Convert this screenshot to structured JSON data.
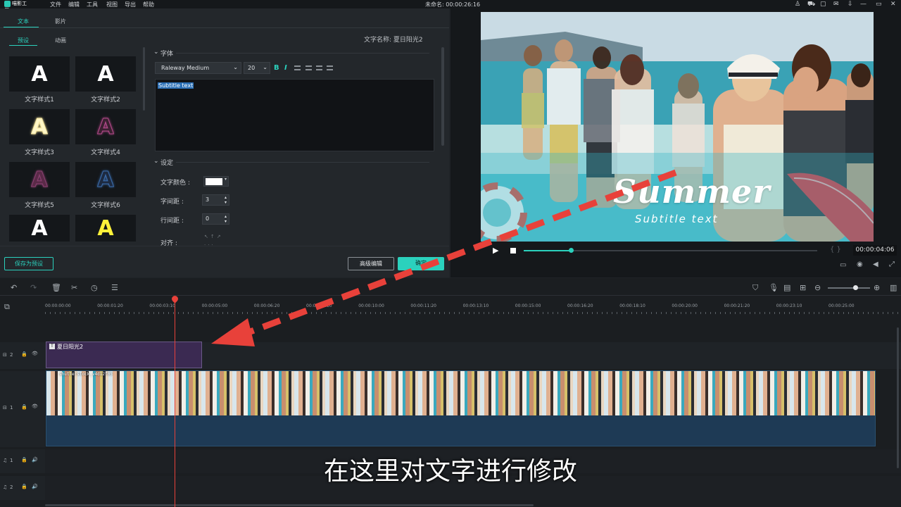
{
  "menubar": {
    "logo": "喵影工厂",
    "items": [
      "文件",
      "编辑",
      "工具",
      "视图",
      "导出",
      "帮助"
    ],
    "project_title": "未命名: 00:00:26:16"
  },
  "left": {
    "tabs": [
      "文本",
      "影片"
    ],
    "subtabs": [
      "预设",
      "动画"
    ],
    "text_name": "文字名称: 夏日阳光2",
    "styles": [
      {
        "label": "文字样式1",
        "color": "#ffffff",
        "glow": "none"
      },
      {
        "label": "文字样式2",
        "color": "#ffffff",
        "glow": "none"
      },
      {
        "label": "文字样式3",
        "color": "#fff7c8",
        "glow": "#f7e7a0"
      },
      {
        "label": "文字样式4",
        "color": "#3a2030",
        "glow": "#b04888"
      },
      {
        "label": "文字样式5",
        "color": "#5a2a48",
        "glow": "#8a4070"
      },
      {
        "label": "文字样式6",
        "color": "#1d2a40",
        "glow": "#3a6aa8"
      },
      {
        "label": "",
        "color": "#ffffff",
        "glow": "none"
      },
      {
        "label": "",
        "color": "#fff23a",
        "glow": "none"
      }
    ],
    "font_section": "字体",
    "font_name": "Raleway Medium",
    "font_size": "20",
    "bold": "B",
    "italic": "I",
    "text_content": "Subtitle text",
    "settings_section": "设定",
    "settings": {
      "color_label": "文字颜色 :",
      "color_value": "#ffffff",
      "spacing_label": "字间距 :",
      "spacing_value": "3",
      "line_label": "行间距 :",
      "line_value": "0",
      "align_label": "对齐 :"
    },
    "save_preset": "保存为预设",
    "advanced": "高级编辑",
    "ok": "确定"
  },
  "preview": {
    "title_text": "Summer",
    "subtitle_text": "Subtitle text",
    "timecode": "00:00:04:06",
    "progress": 0.16
  },
  "timeline": {
    "ruler": [
      "00:00:00:00",
      "00:00:01:20",
      "00:00:03:10",
      "00:00:05:00",
      "00:00:06:20",
      "00:00:08:10",
      "00:00:10:00",
      "00:00:11:20",
      "00:00:13:10",
      "00:00:15:00",
      "00:00:16:20",
      "00:00:18:10",
      "00:00:20:00",
      "00:00:21:20",
      "00:00:23:10",
      "00:00:25:00"
    ],
    "text_clip": "夏日阳光2",
    "video_clip": "shutterstock_v4d12f05",
    "tracks": [
      "2",
      "1",
      "1",
      "2"
    ]
  },
  "caption": "在这里对文字进行修改",
  "colors": {
    "accent": "#2bd1bd",
    "playhead": "#e8413a",
    "arrow": "#e8413a",
    "text_clip": "#3b2a52",
    "video_track": "#1e3a55"
  }
}
